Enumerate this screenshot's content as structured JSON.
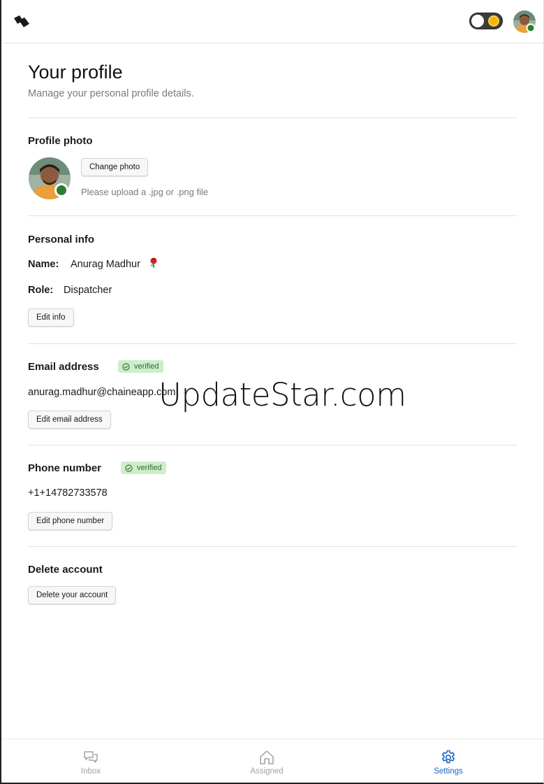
{
  "topbar": {
    "logo_icon": "chaine-logo-icon",
    "theme_toggle_icon": "sun-icon",
    "avatar_icon": "user-avatar"
  },
  "page": {
    "title": "Your profile",
    "subtitle": "Manage your personal profile details."
  },
  "profile_photo": {
    "title": "Profile photo",
    "change_button": "Change photo",
    "hint": "Please upload a .jpg or .png file"
  },
  "personal_info": {
    "title": "Personal info",
    "name_label": "Name:",
    "name_value": "Anurag Madhur",
    "role_label": "Role:",
    "role_value": "Dispatcher",
    "edit_button": "Edit info"
  },
  "email": {
    "title": "Email address",
    "badge": "verified",
    "value": "anurag.madhur@chaineapp.com",
    "edit_button": "Edit email address"
  },
  "phone": {
    "title": "Phone number",
    "badge": "verified",
    "value": "+1+14782733578",
    "edit_button": "Edit phone number"
  },
  "delete_account": {
    "title": "Delete account",
    "button": "Delete your account"
  },
  "watermark": "UpdateStar.com",
  "nav": {
    "items": [
      {
        "label": "Inbox",
        "icon": "chat-bubbles-icon"
      },
      {
        "label": "Assigned",
        "icon": "home-icon"
      },
      {
        "label": "Settings",
        "icon": "gear-icon"
      }
    ],
    "active_color": "#1565c0",
    "inactive_color": "#a0a0a0"
  },
  "colors": {
    "verified_bg": "#cdeec9",
    "verified_text": "#2d6a2f",
    "online_dot": "#2e7d32"
  }
}
